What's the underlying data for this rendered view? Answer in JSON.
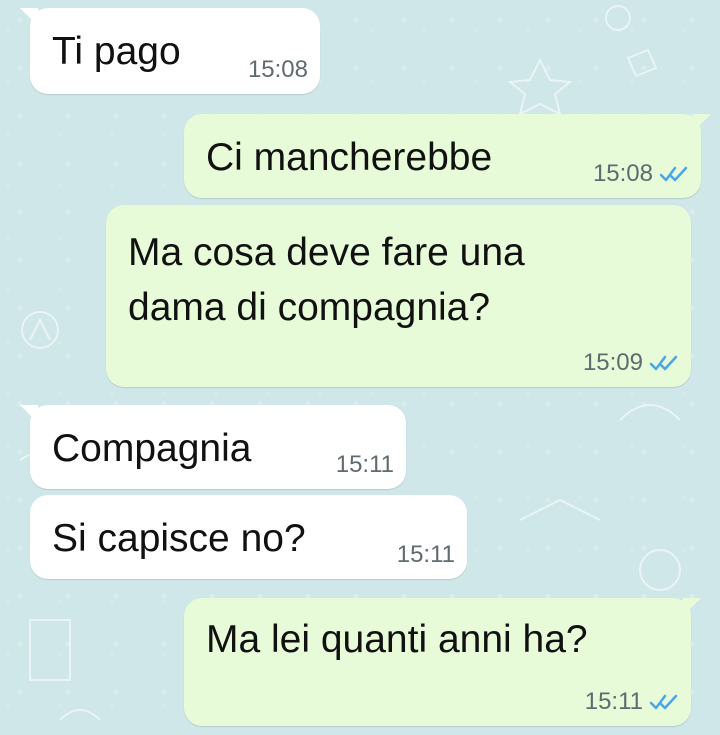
{
  "messages": [
    {
      "text": "Ti pago",
      "time": "15:08",
      "direction": "incoming"
    },
    {
      "text": "Ci mancherebbe",
      "time": "15:08",
      "direction": "outgoing",
      "status_icon": "double-check-read-icon"
    },
    {
      "text": "Ma cosa deve fare una\ndama di compagnia?",
      "time": "15:09",
      "direction": "outgoing",
      "status_icon": "double-check-read-icon"
    },
    {
      "text": "Compagnia",
      "time": "15:11",
      "direction": "incoming"
    },
    {
      "text": "Si capisce no?",
      "time": "15:11",
      "direction": "incoming"
    },
    {
      "text": "Ma lei quanti anni ha?",
      "time": "15:11",
      "direction": "outgoing",
      "status_icon": "double-check-read-icon"
    }
  ],
  "colors": {
    "chat_background": "#cfe7e8",
    "incoming_bubble": "#ffffff",
    "outgoing_bubble": "#e7fbd9",
    "read_check": "#4aa6e8",
    "timestamp": "#5f6b6f"
  }
}
